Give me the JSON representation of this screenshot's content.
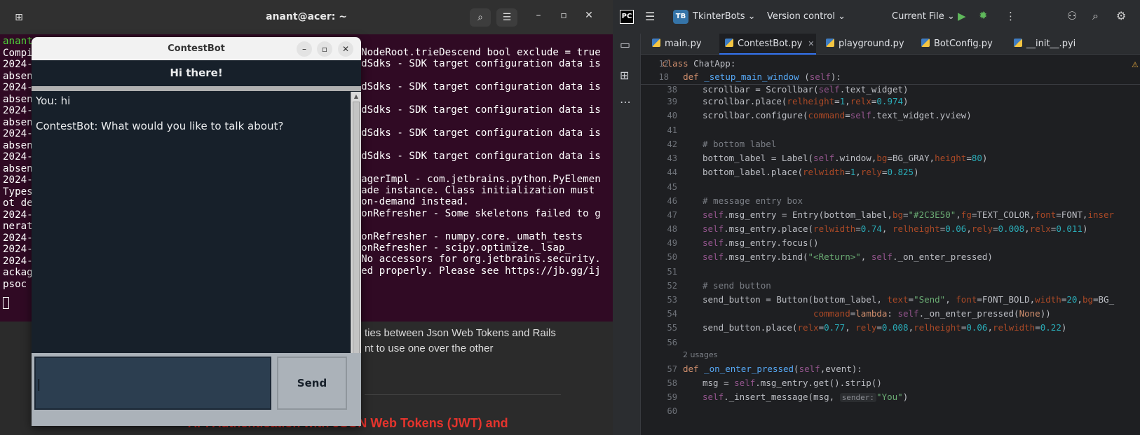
{
  "terminal": {
    "title": "anant@acer: ~",
    "lines_left": [
      "anant",
      "Compi",
      "2024-",
      "absen",
      "2024-",
      "absen",
      "2024-",
      "absen",
      "2024-",
      "absen",
      "2024-",
      "absen",
      "2024-",
      "Types",
      "ot de",
      "2024-",
      "nerat",
      "2024-",
      "2024-",
      "2024-",
      "ackag",
      "psoc"
    ],
    "lines_right": [
      "rtNodeRoot.trieDescend bool exclude = true",
      "sedSdks - SDK target configuration data is",
      "sedSdks - SDK target configuration data is",
      "sedSdks - SDK target configuration data is",
      "sedSdks - SDK target configuration data is",
      "sedSdks - SDK target configuration data is",
      "anagerImpl - com.jetbrains.python.PyElemen",
      "acade instance. Class initialization must",
      "e on-demand instead.",
      "etonRefresher - Some skeletons failed to g",
      "etonRefresher - numpy.core._umath_tests",
      "etonRefresher - scipy.optimize._lsap_",
      "- No accessors for org.jetbrains.security.",
      "ized properly. Please see https://jb.gg/ij"
    ]
  },
  "browser": {
    "line1": "ties between Json Web Tokens and Rails",
    "line2": "nt to use one over the other",
    "heading": "API Authentication with JSON Web Tokens (JWT) and"
  },
  "contestbot": {
    "window_title": "ContestBot",
    "header": "Hi there!",
    "messages": [
      "You: hi",
      "ContestBot: What would you like to talk about?"
    ],
    "entry_value": "",
    "send_label": "Send",
    "colors": {
      "bg": "#17202a",
      "entry": "#2c3e50",
      "gray": "#abb2b9",
      "text": "#eaecee"
    }
  },
  "ide": {
    "logo": "PC",
    "project_badge": "TB",
    "project": "TkinterBots",
    "vcs": "Version control",
    "run_config": "Current File",
    "tabs": [
      {
        "label": "main.py",
        "active": false
      },
      {
        "label": "ContestBot.py",
        "active": true
      },
      {
        "label": "playground.py",
        "active": false
      },
      {
        "label": "BotConfig.py",
        "active": false
      },
      {
        "label": "__init__.pyi",
        "active": false
      }
    ],
    "sticky": [
      {
        "num": "12",
        "code": "class ChatApp:"
      },
      {
        "num": "18",
        "code": "    def _setup_main_window (self):"
      }
    ],
    "usages_label": "2 usages",
    "inlay_sender": "sender:",
    "line_numbers": [
      "38",
      "39",
      "40",
      "41",
      "42",
      "43",
      "44",
      "45",
      "46",
      "47",
      "48",
      "49",
      "50",
      "51",
      "52",
      "53",
      "54",
      "55",
      "56",
      "57",
      "58",
      "59",
      "60"
    ]
  }
}
